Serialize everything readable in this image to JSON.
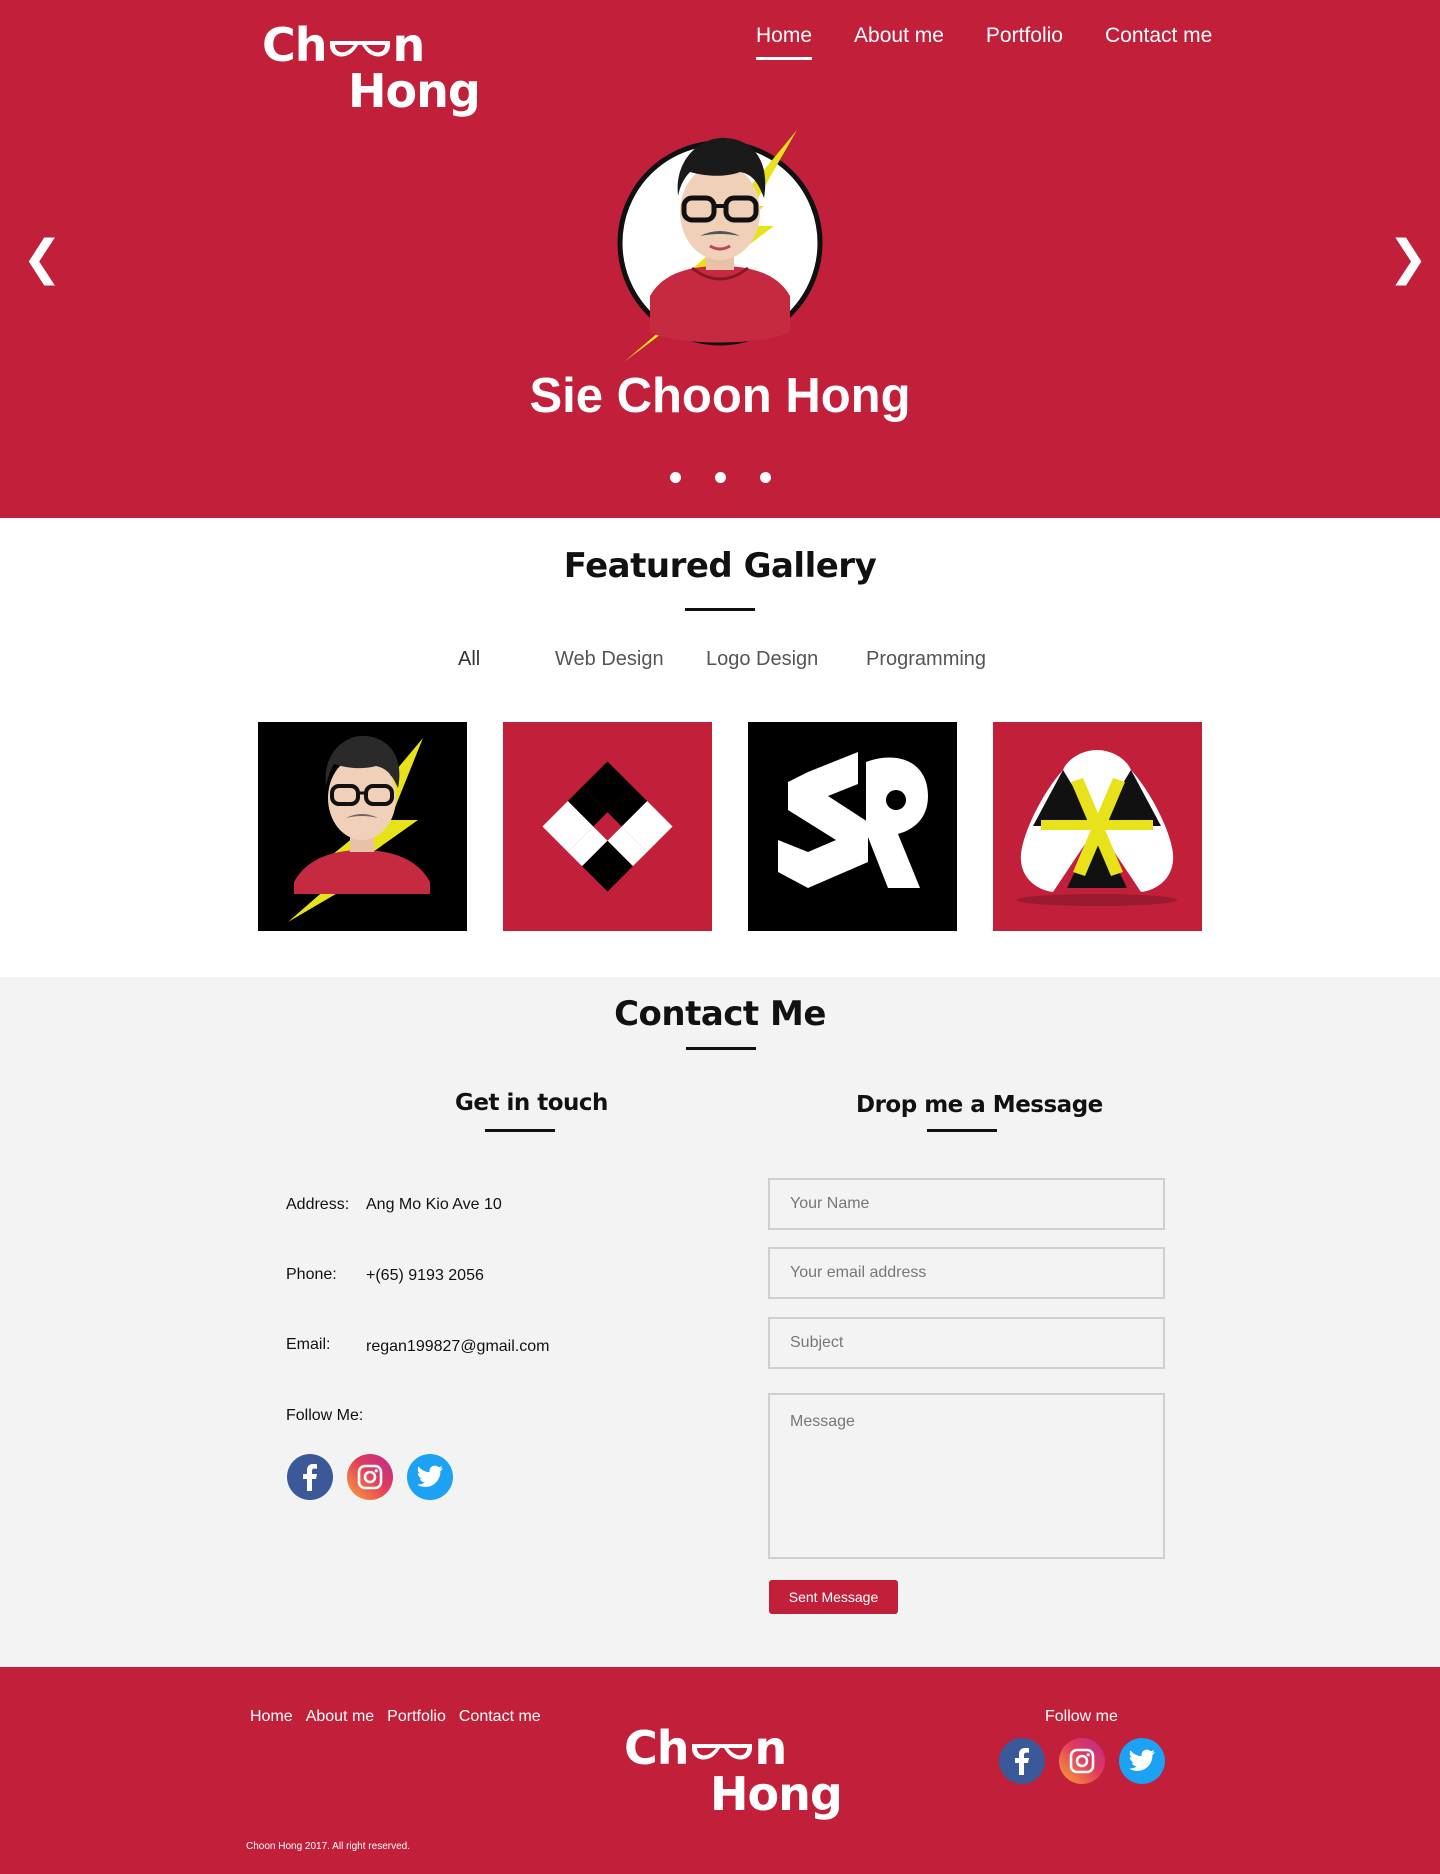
{
  "brand": {
    "logo_line1_a": "Ch",
    "logo_line1_b": "n",
    "logo_line2": "Hong"
  },
  "nav": {
    "items": [
      {
        "label": "Home",
        "active": true
      },
      {
        "label": "About me",
        "active": false
      },
      {
        "label": "Portfolio",
        "active": false
      },
      {
        "label": "Contact me",
        "active": false
      }
    ]
  },
  "hero": {
    "name": "Sie Choon Hong",
    "prev_glyph": "❮",
    "next_glyph": "❯",
    "slide_count": 3
  },
  "gallery": {
    "title": "Featured Gallery",
    "filters": [
      "All",
      "Web Design",
      "Logo Design",
      "Programming"
    ],
    "active_filter": "All",
    "items": [
      {
        "icon": "avatar-portrait-icon",
        "background": "#000000"
      },
      {
        "icon": "x-cross-logo-icon",
        "background": "#c11f3a"
      },
      {
        "icon": "sr-monogram-logo-icon",
        "background": "#000000"
      },
      {
        "icon": "triangle-x-logo-icon",
        "background": "#c11f3a"
      }
    ]
  },
  "contact": {
    "title": "Contact Me",
    "left_title": "Get in touch",
    "right_title": "Drop me a Message",
    "address_label": "Address:",
    "address_value": "Ang Mo Kio Ave 10",
    "phone_label": "Phone:",
    "phone_value": "+(65) 9193 2056",
    "email_label": "Email:",
    "email_value": "regan199827@gmail.com",
    "follow_label": "Follow Me:",
    "form": {
      "name_placeholder": "Your Name",
      "email_placeholder": "Your email address",
      "subject_placeholder": "Subject",
      "message_placeholder": "Message",
      "submit_label": "Sent Message"
    }
  },
  "footer": {
    "nav": [
      "Home",
      "About me",
      "Portfolio",
      "Contact me"
    ],
    "follow_label": "Follow me",
    "copyright": "Choon Hong 2017. All right reserved."
  },
  "social_icons": [
    "facebook-icon",
    "instagram-icon",
    "twitter-icon"
  ],
  "colors": {
    "brand": "#c11f3a",
    "contact_bg": "#f3f3f3",
    "facebook": "#3b5998",
    "twitter": "#1da1f2"
  }
}
